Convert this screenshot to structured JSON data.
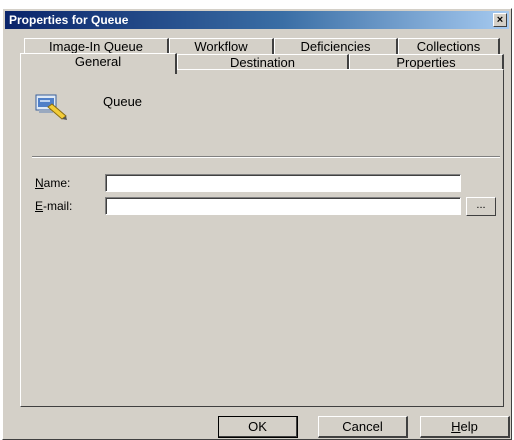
{
  "window": {
    "title": "Properties for Queue",
    "close_glyph": "×"
  },
  "tabs": {
    "row_back": [
      "Image-In Queue",
      "Workflow",
      "Deficiencies",
      "Collections"
    ],
    "row_front": [
      "General",
      "Destination",
      "Properties"
    ],
    "active": "General"
  },
  "general": {
    "icon": "queue-icon",
    "type_label": "Queue",
    "name_label_accel": "N",
    "name_label_rest": "ame:",
    "name_value": "",
    "email_label_accel": "E",
    "email_label_rest": "-mail:",
    "email_value": "",
    "browse_label": "..."
  },
  "buttons": {
    "ok": "OK",
    "cancel": "Cancel",
    "help_accel": "H",
    "help_rest": "elp"
  },
  "colors": {
    "dialog_bg": "#d4d0c8",
    "title_bar_start": "#0a246a",
    "title_bar_end": "#a6caf0"
  }
}
